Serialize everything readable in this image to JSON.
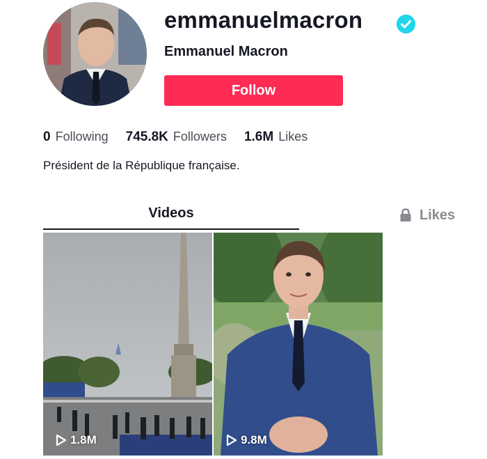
{
  "profile": {
    "username": "emmanuelmacron",
    "display_name": "Emmanuel Macron",
    "follow_label": "Follow",
    "verified": true,
    "bio": "Président de la République française."
  },
  "stats": {
    "following": {
      "value": "0",
      "label": "Following"
    },
    "followers": {
      "value": "745.8K",
      "label": "Followers"
    },
    "likes": {
      "value": "1.6M",
      "label": "Likes"
    }
  },
  "tabs": {
    "videos": "Videos",
    "likes": "Likes"
  },
  "videos": [
    {
      "views": "1.8M"
    },
    {
      "views": "9.8M"
    }
  ],
  "colors": {
    "accent": "#fe2c55",
    "verified": "#20d5ec",
    "text": "#161823",
    "muted": "#8a8b91"
  },
  "icons": [
    "verified-badge-icon",
    "lock-icon",
    "play-icon"
  ]
}
